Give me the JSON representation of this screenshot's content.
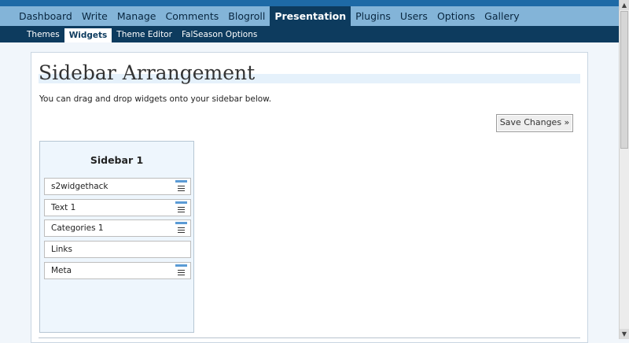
{
  "main_nav": {
    "items": [
      {
        "label": "Dashboard"
      },
      {
        "label": "Write"
      },
      {
        "label": "Manage"
      },
      {
        "label": "Comments"
      },
      {
        "label": "Blogroll"
      },
      {
        "label": "Presentation",
        "active": true
      },
      {
        "label": "Plugins"
      },
      {
        "label": "Users"
      },
      {
        "label": "Options"
      },
      {
        "label": "Gallery"
      }
    ]
  },
  "sub_nav": {
    "items": [
      {
        "label": "Themes"
      },
      {
        "label": "Widgets",
        "active": true
      },
      {
        "label": "Theme Editor"
      },
      {
        "label": "FalSeason Options"
      }
    ]
  },
  "page": {
    "title": "Sidebar Arrangement",
    "intro": "You can drag and drop widgets onto your sidebar below.",
    "save_label": "Save Changes »"
  },
  "sidebar": {
    "title": "Sidebar 1",
    "widgets": [
      {
        "label": "s2widgethack",
        "has_controls": true
      },
      {
        "label": "Text 1",
        "has_controls": true
      },
      {
        "label": "Categories 1",
        "has_controls": true
      },
      {
        "label": "Links",
        "has_controls": false
      },
      {
        "label": "Meta",
        "has_controls": true
      }
    ]
  },
  "icons": {
    "widget_handle": "widget-control-icon",
    "scroll_up": "▲",
    "scroll_down": "▼"
  },
  "colors": {
    "top_band": "#1e6aa6",
    "main_nav_bg": "#83b4d8",
    "active_nav": "#0d3b5e",
    "sidebar_bg": "#eef6fd"
  }
}
